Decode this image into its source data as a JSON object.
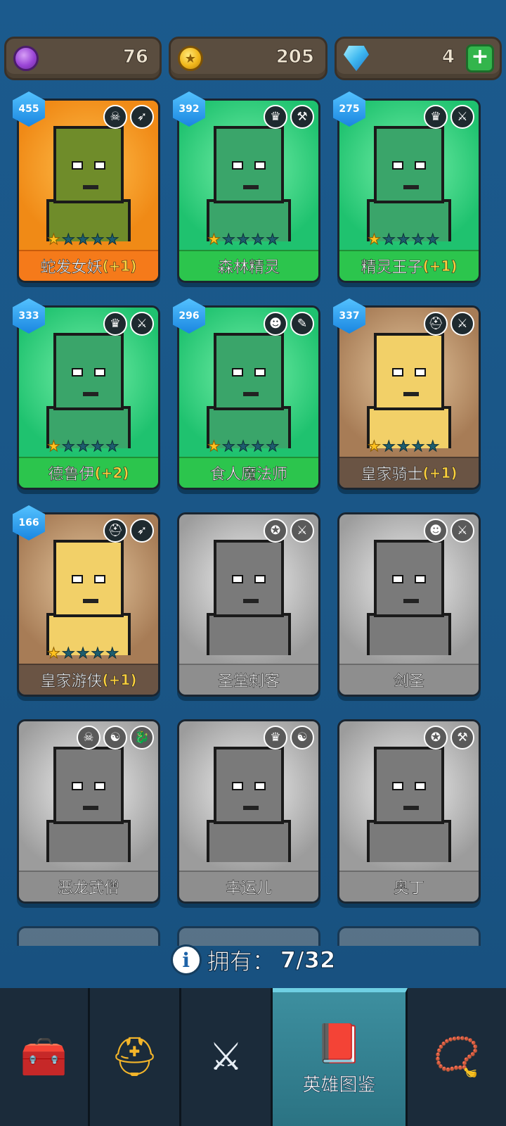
{
  "resources": {
    "purple_coins": "76",
    "gold_coins": "205",
    "gems": "4",
    "add_label": "+"
  },
  "heroes": [
    {
      "name": "蛇发女妖",
      "bonus": "(+1)",
      "level": "455",
      "stars": 1,
      "style": "orange",
      "traits": [
        "☠",
        "➶"
      ],
      "unlocked": true
    },
    {
      "name": "森林精灵",
      "bonus": "",
      "level": "392",
      "stars": 1,
      "style": "green",
      "traits": [
        "♛",
        "⚒"
      ],
      "unlocked": true
    },
    {
      "name": "精灵王子",
      "bonus": "(+1)",
      "level": "275",
      "stars": 1,
      "style": "green",
      "traits": [
        "♛",
        "⚔"
      ],
      "unlocked": true
    },
    {
      "name": "德鲁伊",
      "bonus": "(+2)",
      "level": "333",
      "stars": 1,
      "style": "green",
      "traits": [
        "♛",
        "⚔"
      ],
      "unlocked": true
    },
    {
      "name": "食人魔法师",
      "bonus": "",
      "level": "296",
      "stars": 1,
      "style": "green",
      "traits": [
        "☻",
        "✎"
      ],
      "unlocked": true
    },
    {
      "name": "皇家骑士",
      "bonus": "(+1)",
      "level": "337",
      "stars": 1,
      "style": "brown",
      "traits": [
        "⛑",
        "⚔"
      ],
      "unlocked": true
    },
    {
      "name": "皇家游侠",
      "bonus": "(+1)",
      "level": "166",
      "stars": 1,
      "style": "brown",
      "traits": [
        "⛑",
        "➶"
      ],
      "unlocked": true
    },
    {
      "name": "圣堂刺客",
      "bonus": "",
      "level": "",
      "stars": 0,
      "style": "gray",
      "traits": [
        "✪",
        "⚔"
      ],
      "unlocked": false
    },
    {
      "name": "剑圣",
      "bonus": "",
      "level": "",
      "stars": 0,
      "style": "gray",
      "traits": [
        "☻",
        "⚔"
      ],
      "unlocked": false
    },
    {
      "name": "恶龙武僧",
      "bonus": "",
      "level": "",
      "stars": 0,
      "style": "gray",
      "traits": [
        "☠",
        "☯",
        "🐉"
      ],
      "unlocked": false
    },
    {
      "name": "幸运儿",
      "bonus": "",
      "level": "",
      "stars": 0,
      "style": "gray",
      "traits": [
        "♛",
        "☯"
      ],
      "unlocked": false
    },
    {
      "name": "奥丁",
      "bonus": "",
      "level": "",
      "stars": 0,
      "style": "gray",
      "traits": [
        "✪",
        "⚒"
      ],
      "unlocked": false
    }
  ],
  "owned": {
    "label": "拥有：",
    "count": "7/32"
  },
  "nav": {
    "tabs": [
      {
        "name": "chest",
        "icon": "treasure-chest-icon",
        "glyph": "🧰",
        "label": ""
      },
      {
        "name": "heroes",
        "icon": "viking-helmet-icon",
        "glyph": "⛑",
        "label": ""
      },
      {
        "name": "battle",
        "icon": "crossed-swords-icon",
        "glyph": "⚔",
        "label": ""
      },
      {
        "name": "hero-codex",
        "icon": "spellbook-icon",
        "glyph": "📕",
        "label": "英雄图鉴",
        "active": true
      },
      {
        "name": "amulet",
        "icon": "amulet-icon",
        "glyph": "📿",
        "label": ""
      }
    ]
  },
  "colors": {
    "background": "#1b5a8d",
    "orange_card": "#f08a16",
    "green_card": "#1fc26f",
    "brown_card": "#a77c56",
    "gray_card": "#9c9c9c",
    "level_badge": "#1a86e0",
    "star_gold": "#ffc21f",
    "bonus_yellow": "#ffd23d"
  }
}
